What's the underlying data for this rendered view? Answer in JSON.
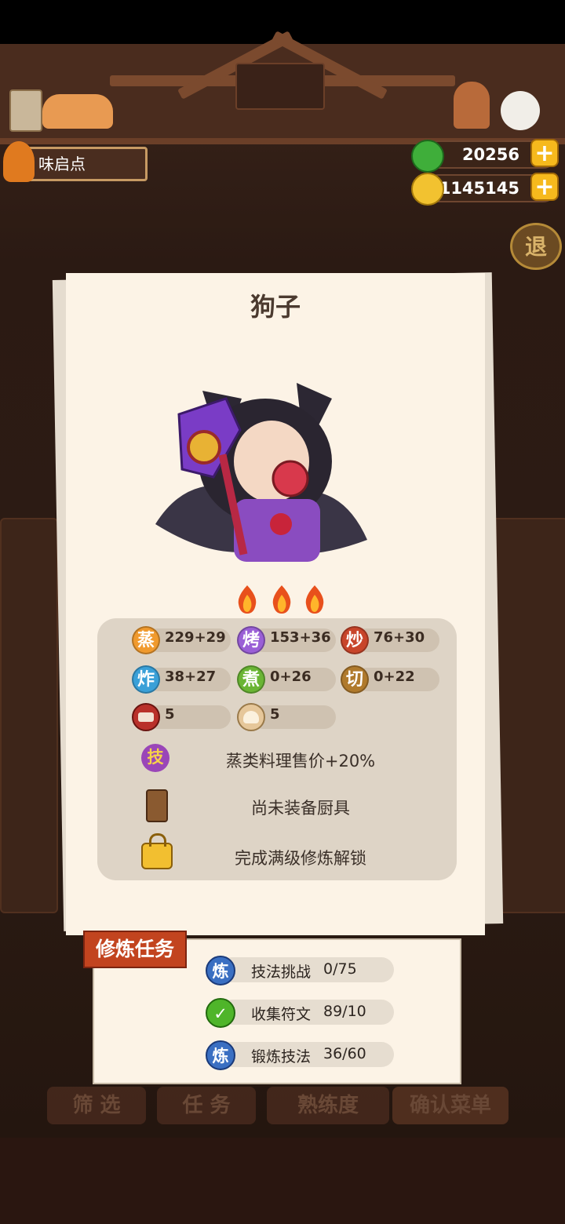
{
  "header": {
    "location_label": "味启点",
    "jade_amount": "20256",
    "coin_amount": "1145145",
    "exit_label": "退"
  },
  "background_menu": {
    "filter_label": "筛 选",
    "task_label": "任 务",
    "proficiency_label": "熟练度",
    "confirm_label": "确认菜单"
  },
  "character": {
    "name": "狗子",
    "rarity_flames": 3,
    "stats": [
      {
        "badge": "蒸",
        "value": "229+29",
        "color": "#f09a2e"
      },
      {
        "badge": "烤",
        "value": "153+36",
        "color": "#9a5fd6"
      },
      {
        "badge": "炒",
        "value": "76+30",
        "color": "#c8452a"
      },
      {
        "badge": "炸",
        "value": "38+27",
        "color": "#3aa0d8"
      },
      {
        "badge": "煮",
        "value": "0+26",
        "color": "#6ab534"
      },
      {
        "badge": "切",
        "value": "0+22",
        "color": "#b07a2c"
      }
    ],
    "materials": [
      {
        "icon": "meat-icon",
        "value": "5"
      },
      {
        "icon": "bun-icon",
        "value": "5"
      }
    ],
    "skill_badge": "技",
    "skill_text": "蒸类料理售价+20%",
    "equipment_text": "尚未装备厨具",
    "lock_text": "完成满级修炼解锁"
  },
  "training": {
    "tag": "修炼任务",
    "tasks": [
      {
        "icon": "炼",
        "label": "技法挑战",
        "progress": "0/75",
        "done": false
      },
      {
        "icon": "✓",
        "label": "收集符文",
        "progress": "89/10",
        "done": true
      },
      {
        "icon": "炼",
        "label": "锻炼技法",
        "progress": "36/60",
        "done": false
      }
    ]
  },
  "colors": {
    "card_bg": "#fcf3e6",
    "panel_bg": "#ded4c6",
    "tag_red": "#c2441f",
    "gold": "#f6b91d"
  }
}
